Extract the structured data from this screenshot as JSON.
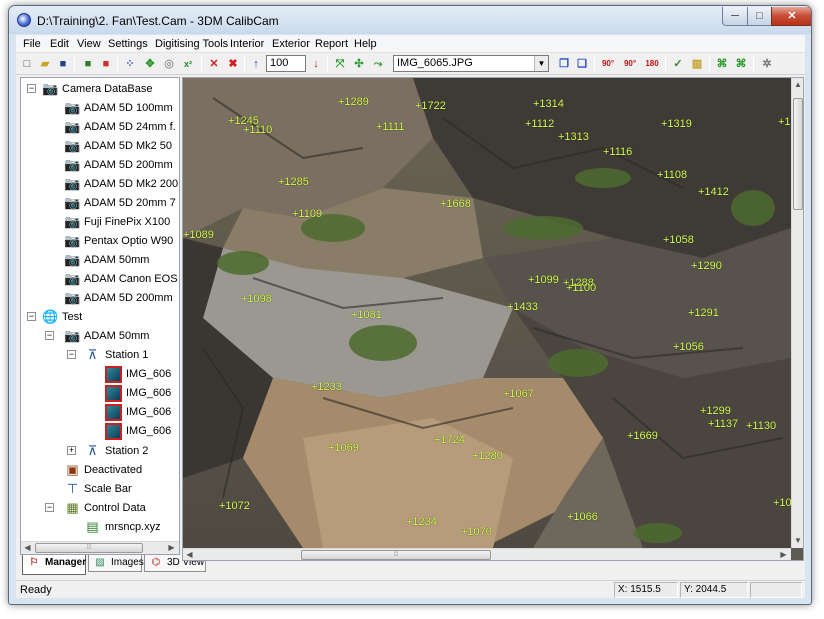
{
  "window": {
    "title": "D:\\Training\\2. Fan\\Test.Cam - 3DM CalibCam",
    "minimize_glyph": "─",
    "maximize_glyph": "□",
    "close_glyph": "✕"
  },
  "menu": [
    "File",
    "Edit",
    "View",
    "Settings",
    "Digitising Tools",
    "Interior",
    "Exterior",
    "Report",
    "Help"
  ],
  "toolbar": {
    "step_value": "100",
    "image_selector": "IMG_6065.JPG",
    "rotate_labels": [
      "90°",
      "90°",
      "180"
    ]
  },
  "tree": {
    "camera_database": "Camera DataBase",
    "cameras": [
      "ADAM 5D 100mm",
      "ADAM 5D 24mm f.",
      "ADAM 5D Mk2 50",
      "ADAM 5D 200mm",
      "ADAM 5D Mk2 200",
      "ADAM 5D 20mm 7",
      "Fuji FinePix X100",
      "Pentax Optio W90",
      "ADAM 50mm",
      "ADAM Canon EOS",
      "ADAM 5D 200mm"
    ],
    "project": "Test",
    "project_camera": "ADAM 50mm",
    "station1": "Station 1",
    "images": [
      "IMG_606",
      "IMG_606",
      "IMG_606",
      "IMG_606"
    ],
    "station2": "Station 2",
    "deactivated": "Deactivated",
    "scale_bar": "Scale Bar",
    "control_data": "Control Data",
    "control_file": "mrsncp.xyz"
  },
  "tabs": [
    "Manager",
    "Images",
    "3D View"
  ],
  "status": {
    "text": "Ready",
    "x": "X: 1515.5",
    "y": "Y: 2044.5"
  },
  "points": [
    "+1289",
    "+1722",
    "+1314",
    "+1245",
    "+1110",
    "+1111",
    "+1112",
    "+1313",
    "+1319",
    "+1",
    "+1116",
    "+1285",
    "+1108",
    "+1412",
    "+1109",
    "+1668",
    "+1089",
    "+1058",
    "+1290",
    "+1099",
    "+1288",
    "+1100",
    "+1098",
    "+1433",
    "+1081",
    "+1291",
    "+1056",
    "+1233",
    "+1067",
    "+1299",
    "+1137",
    "+1130",
    "+1669",
    "+1069",
    "+1724",
    "+1280",
    "+1072",
    "+1234",
    "+1070",
    "+1066",
    "+10"
  ]
}
